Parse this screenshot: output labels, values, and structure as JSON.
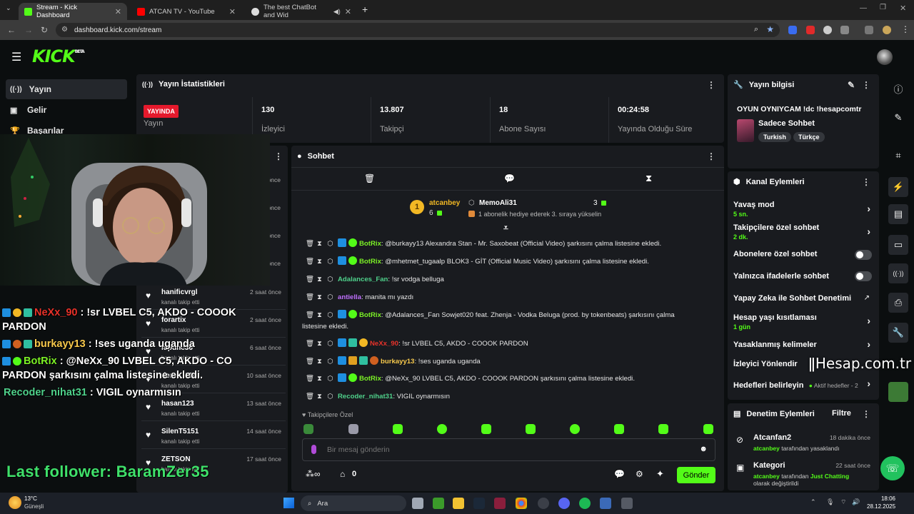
{
  "browser": {
    "tabs": [
      {
        "title": "Stream - Kick Dashboard",
        "color": "#53fc18",
        "active": true
      },
      {
        "title": "ATCAN TV - YouTube",
        "color": "#ff0000"
      },
      {
        "title": "The best ChatBot and Wid",
        "color": "#cccccc"
      }
    ],
    "url": "dashboard.kick.com/stream"
  },
  "kick": {
    "logo": "KICK",
    "logo_sup": "BETA"
  },
  "sidebar": {
    "items": [
      {
        "label": "Yayın",
        "icon": "broadcast-icon"
      },
      {
        "label": "Gelir",
        "icon": "revenue-icon"
      },
      {
        "label": "Başarılar",
        "icon": "trophy-icon"
      }
    ]
  },
  "stats": {
    "title": "Yayın İstatistikleri",
    "live_badge": "YAYINDA",
    "items": [
      {
        "value": "",
        "label": "Yayın"
      },
      {
        "value": "130",
        "label": "İzleyici"
      },
      {
        "value": "13.807",
        "label": "Takipçi"
      },
      {
        "value": "18",
        "label": "Abone Sayısı"
      },
      {
        "value": "00:24:58",
        "label": "Yayında Olduğu Süre"
      }
    ]
  },
  "overlay": {
    "lines": [
      {
        "user": "NeXx_90",
        "user_color": "#e8322a",
        "text": " : !sr LVBEL C5, AKDO - COOOK"
      },
      {
        "user": "",
        "user_color": "#ffffff",
        "text": "PARDON"
      },
      {
        "user": "burkayy13",
        "user_color": "#f7c94c",
        "text": " : !ses uganda uganda"
      },
      {
        "user": "BotRix",
        "user_color": "#7cf226",
        "text": " : @NeXx_90 LVBEL C5, AKDO - CO"
      },
      {
        "user": "",
        "user_color": "#ffffff",
        "text": "PARDON şarkısını çalma listesine ekledi."
      },
      {
        "user": "Recoder_nihat31",
        "user_color": "#4fd18b",
        "text": " : VIGIL oynarmısın"
      }
    ],
    "last_follower": "Last follower: BaramZer35"
  },
  "followers": {
    "peek_times": [
      "önce",
      "önce",
      "önce",
      "önce"
    ],
    "rows": [
      {
        "name": "hanificvrgl",
        "sub": "kanalı takip etti",
        "ago": "2 saat önce"
      },
      {
        "name": "forartix",
        "sub": "kanalı takip etti",
        "ago": "2 saat önce"
      },
      {
        "name": "lupunc36",
        "sub": "kanalı takip etti",
        "ago": "6 saat önce"
      },
      {
        "name": "demir1209",
        "sub": "kanalı takip etti",
        "ago": "10 saat önce"
      },
      {
        "name": "hasan123",
        "sub": "kanalı takip etti",
        "ago": "13 saat önce"
      },
      {
        "name": "SilenT5151",
        "sub": "kanalı takip etti",
        "ago": "14 saat önce"
      },
      {
        "name": "ZETSON",
        "sub": "kanalı takip etti",
        "ago": "17 saat önce"
      }
    ]
  },
  "chat": {
    "title": "Sohbet",
    "top_gifter": {
      "rank": "1",
      "user": "atcanbey",
      "count": "6",
      "user2": "MemoAli31",
      "count2": "3",
      "note": "1 abonelik hediye ederek 3. sıraya yükselin"
    },
    "messages": [
      {
        "user": "BotRix",
        "color": "#7cf226",
        "text": ": @burkayy13 Alexandra Stan - Mr. Saxobeat (Official Video) şarkısını çalma listesine ekledi."
      },
      {
        "user": "BotRix",
        "color": "#7cf226",
        "text": ": @mhetmet_tugaalp BLOK3 - GİT (Official Music Video) şarkısını çalma listesine ekledi."
      },
      {
        "user": "Adalances_Fan",
        "color": "#4fd18b",
        "text": ": !sr vodga belluga"
      },
      {
        "user": "antiella",
        "color": "#c070ff",
        "text": ": manita mı yazdı"
      },
      {
        "user": "BotRix",
        "color": "#7cf226",
        "text": ": @Adalances_Fan Sowjet020 feat. Zhenja - Vodka Beluga (prod. by tokenbeats) şarkısını çalma"
      },
      {
        "user": "",
        "color": "#ffffff",
        "text": "listesine ekledi."
      },
      {
        "user": "NeXx_90",
        "color": "#e8322a",
        "text": ": !sr LVBEL C5, AKDO - COOOK PARDON"
      },
      {
        "user": "burkayy13",
        "color": "#f7c94c",
        "text": ": !ses uganda uganda"
      },
      {
        "user": "BotRix",
        "color": "#7cf226",
        "text": ": @NeXx_90 LVBEL C5, AKDO - COOOK PARDON şarkısını çalma listesine ekledi."
      },
      {
        "user": "Recoder_nihat31",
        "color": "#4fd18b",
        "text": ": VIGIL oynarmısın"
      }
    ],
    "followers_only": "Takipçilere Özel",
    "input_placeholder": "Bir mesaj gönderin",
    "points": "0",
    "send": "Gönder"
  },
  "stream_info": {
    "title": "Yayın bilgisi",
    "stream_title": "OYUN OYNIYCAM !dc !hesapcomtr",
    "category": "Sadece Sohbet",
    "tags": [
      "Turkish",
      "Türkçe"
    ]
  },
  "channel_actions": {
    "title": "Kanal Eylemleri",
    "items": [
      {
        "name": "Yavaş mod",
        "sub": "5 sn."
      },
      {
        "name": "Takipçilere özel sohbet",
        "sub": "2 dk."
      },
      {
        "name": "Abonelere özel sohbet",
        "sub": ""
      },
      {
        "name": "Yalnızca ifadelerle sohbet",
        "sub": ""
      },
      {
        "name": "Yapay Zeka ile Sohbet Denetimi",
        "sub": ""
      },
      {
        "name": "Hesap yaşı kısıtlaması",
        "sub": "1 gün"
      },
      {
        "name": "Yasaklanmış kelimeler",
        "sub": ""
      },
      {
        "name": "İzleyici Yönlendir",
        "sub": ""
      },
      {
        "name": "Hedefleri belirleyin",
        "sub": "Aktif hedefler - 2"
      }
    ]
  },
  "watermark": "Hesap.com.tr",
  "moderation": {
    "title": "Denetim Eylemleri",
    "filter": "Filtre",
    "items": [
      {
        "name": "Atcanfan2",
        "ago": "18 dakika önce",
        "by": "atcanbey",
        "desc": " tarafından yasaklandı"
      },
      {
        "name": "Kategori",
        "ago": "22 saat önce",
        "by": "atcanbey",
        "desc": " tarafından ",
        "extra": "Just Chatting",
        "desc2": "olarak değiştirildi"
      }
    ]
  },
  "taskbar": {
    "weather_temp": "13°C",
    "weather_desc": "Güneşli",
    "search": "Ara",
    "time": "18:06",
    "date": "28.12.2025"
  }
}
